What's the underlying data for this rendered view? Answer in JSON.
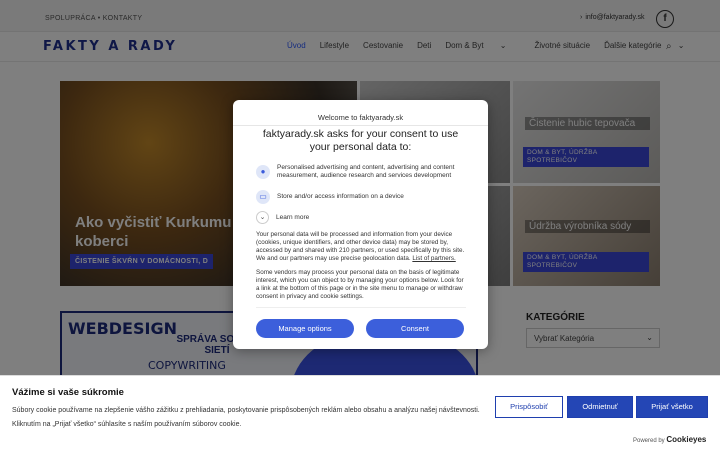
{
  "topbar": {
    "links": "SPOLUPRÁCA • KONTAKTY",
    "email": "info@faktyarady.sk",
    "facebook": "f"
  },
  "header": {
    "logo": "FAKTY A RADY",
    "nav": [
      "Úvod",
      "Lifestyle",
      "Cestovanie",
      "Deti",
      "Dom & Byt",
      "Životné situácie",
      "Ďalšie kategórie"
    ],
    "search_icon": "search-icon"
  },
  "featured": {
    "big": {
      "title": "Ako vyčistiť Kurkumu z koberci",
      "tag": "ČISTENIE ŠKVŔN V DOMÁCNOSTI, D"
    },
    "tiles": [
      {
        "title": "Čistenie hubic tepovača",
        "tag": "DOM & BYT, ÚDRŽBA SPOTREBIČOV"
      },
      {
        "title": "Údržba výrobníka sódy",
        "tag": "DOM & BYT, ÚDRŽBA SPOTREBIČOV"
      }
    ]
  },
  "ad": {
    "headline": "WEBDESIGN",
    "subheadline": "SPRÁVA SOCIÁL SIETÍ",
    "copy": "COPYWRITING"
  },
  "sidebar": {
    "heading": "KATEGÓRIE",
    "select_value": "Vybrať Kategória"
  },
  "consent": {
    "welcome": "Welcome to faktyarady.sk",
    "title": "faktyarady.sk asks for your consent to use your personal data to:",
    "purposes": [
      {
        "icon": "person-icon",
        "text": "Personalised advertising and content, advertising and content measurement, audience research and services development"
      },
      {
        "icon": "device-icon",
        "text": "Store and/or access information on a device"
      }
    ],
    "learn_more": "Learn more",
    "body1_pre": "Your personal data will be processed and information from your device (cookies, unique identifiers, and other device data) may be stored by, accessed by and shared with 210 partners, or used specifically by this site. We and our partners may use precise geolocation data.",
    "partners_link": "List of partners.",
    "body2": "Some vendors may process your personal data on the basis of legitimate interest, which you can object to by managing your options below. Look for a link at the bottom of this page or in the site menu to manage or withdraw consent in privacy and cookie settings.",
    "manage_label": "Manage options",
    "consent_label": "Consent"
  },
  "cookie_banner": {
    "title": "Vážime si vaše súkromie",
    "text": "Súbory cookie používame na zlepšenie vášho zážitku z prehliadania, poskytovanie prispôsobených reklám alebo obsahu a analýzu našej návštevnosti. Kliknutím na „Prijať všetko“ súhlasíte s naším používaním súborov cookie.",
    "customize": "Prispôsobiť",
    "reject": "Odmietnuť",
    "accept": "Prijať všetko",
    "powered_prefix": "Powered by",
    "powered_brand": "Cookieyes"
  }
}
